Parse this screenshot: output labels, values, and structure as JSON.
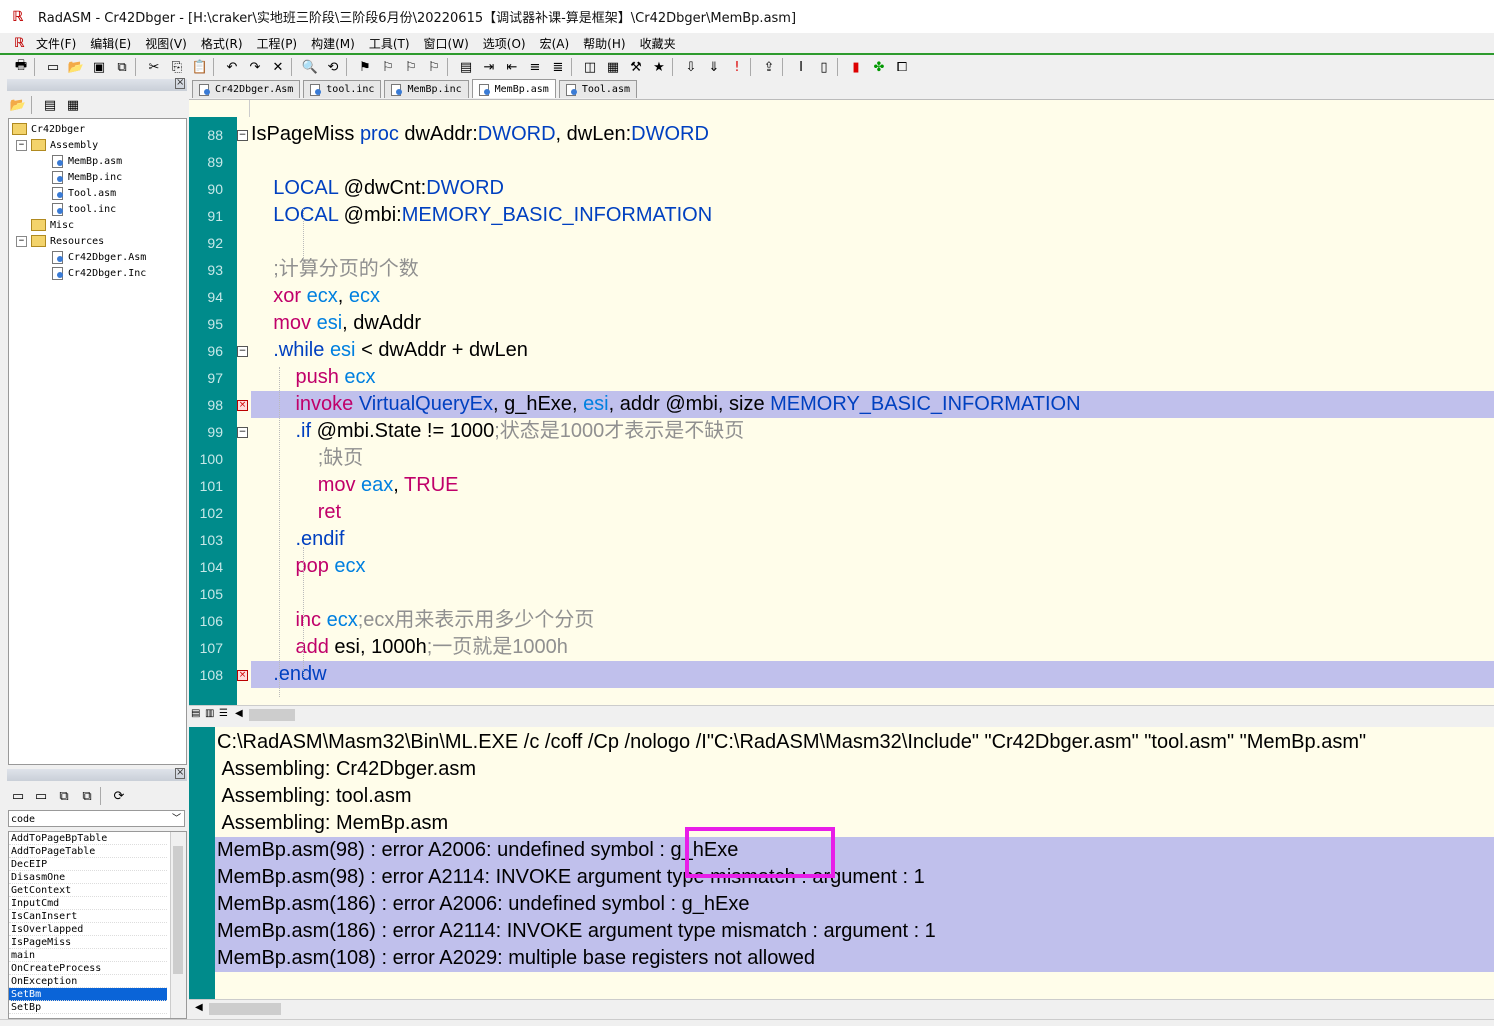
{
  "window": {
    "title": "RadASM - Cr42Dbger - [H:\\craker\\实地班三阶段\\三阶段6月份\\20220615【调试器补课-算是框架】\\Cr42Dbger\\MemBp.asm]"
  },
  "menu": [
    "文件(F)",
    "编辑(E)",
    "视图(V)",
    "格式(R)",
    "工程(P)",
    "构建(M)",
    "工具(T)",
    "窗口(W)",
    "选项(O)",
    "宏(A)",
    "帮助(H)",
    "收藏夹"
  ],
  "tabs": [
    "Cr42Dbger.Asm",
    "tool.inc",
    "MemBp.inc",
    "MemBp.asm",
    "Tool.asm"
  ],
  "active_tab": "MemBp.asm",
  "project": {
    "root": "Cr42Dbger",
    "groups": [
      {
        "name": "Assembly",
        "files": [
          "MemBp.asm",
          "MemBp.inc",
          "Tool.asm",
          "tool.inc"
        ]
      },
      {
        "name": "Misc",
        "files": []
      },
      {
        "name": "Resources",
        "files": [
          "Cr42Dbger.Asm",
          "Cr42Dbger.Inc"
        ]
      }
    ]
  },
  "properties": {
    "combo": "code",
    "procs": [
      "AddToPageBpTable",
      "AddToPageTable",
      "DecEIP",
      "DisasmOne",
      "GetContext",
      "InputCmd",
      "IsCanInsert",
      "IsOverlapped",
      "IsPageMiss",
      "main",
      "OnCreateProcess",
      "OnException",
      "SetBm",
      "SetBp"
    ],
    "selected": "SetBm"
  },
  "code": {
    "line_numbers": [
      "88",
      "89",
      "90",
      "91",
      "92",
      "93",
      "94",
      "95",
      "96",
      "97",
      "98",
      "99",
      "100",
      "101",
      "102",
      "103",
      "104",
      "105",
      "106",
      "107",
      "108"
    ],
    "highlight_lines": [
      "98",
      "108"
    ],
    "lines": [
      [
        [
          "nm",
          "IsPageMiss "
        ],
        [
          "dir",
          "proc "
        ],
        [
          "nm",
          "dwAddr"
        ],
        [
          "op",
          ":"
        ],
        [
          "typ",
          "DWORD"
        ],
        [
          "op",
          ", "
        ],
        [
          "nm",
          "dwLen"
        ],
        [
          "op",
          ":"
        ],
        [
          "typ",
          "DWORD"
        ]
      ],
      [],
      [
        [
          "nm",
          "    "
        ],
        [
          "dir",
          "LOCAL "
        ],
        [
          "nm",
          "@dwCnt"
        ],
        [
          "op",
          ":"
        ],
        [
          "typ",
          "DWORD"
        ]
      ],
      [
        [
          "nm",
          "    "
        ],
        [
          "dir",
          "LOCAL "
        ],
        [
          "nm",
          "@mbi"
        ],
        [
          "op",
          ":"
        ],
        [
          "typ",
          "MEMORY_BASIC_INFORMATION"
        ]
      ],
      [],
      [
        [
          "nm",
          "    "
        ],
        [
          "cm",
          ";计算分页的个数"
        ]
      ],
      [
        [
          "nm",
          "    "
        ],
        [
          "kw",
          "xor "
        ],
        [
          "reg",
          "ecx"
        ],
        [
          "op",
          ", "
        ],
        [
          "reg",
          "ecx"
        ]
      ],
      [
        [
          "nm",
          "    "
        ],
        [
          "kw",
          "mov "
        ],
        [
          "reg",
          "esi"
        ],
        [
          "op",
          ", "
        ],
        [
          "nm",
          "dwAddr"
        ]
      ],
      [
        [
          "nm",
          "    "
        ],
        [
          "dir",
          ".while "
        ],
        [
          "reg",
          "esi "
        ],
        [
          "op",
          "< "
        ],
        [
          "nm",
          "dwAddr "
        ],
        [
          "op",
          "+ "
        ],
        [
          "nm",
          "dwLen"
        ]
      ],
      [
        [
          "nm",
          "        "
        ],
        [
          "kw",
          "push "
        ],
        [
          "reg",
          "ecx"
        ]
      ],
      [
        [
          "nm",
          "        "
        ],
        [
          "kw",
          "invoke "
        ],
        [
          "typ",
          "VirtualQueryEx"
        ],
        [
          "op",
          ", "
        ],
        [
          "nm",
          "g_hExe"
        ],
        [
          "op",
          ", "
        ],
        [
          "reg",
          "esi"
        ],
        [
          "op",
          ", "
        ],
        [
          "nm",
          "addr @mbi"
        ],
        [
          "op",
          ", "
        ],
        [
          "nm",
          "size "
        ],
        [
          "typ",
          "MEMORY_BASIC_INFORMATION"
        ]
      ],
      [
        [
          "nm",
          "        "
        ],
        [
          "dir",
          ".if "
        ],
        [
          "nm",
          "@mbi.State "
        ],
        [
          "op",
          "!= "
        ],
        [
          "nm",
          "1000"
        ],
        [
          "cm",
          ";状态是1000才表示是不缺页"
        ]
      ],
      [
        [
          "nm",
          "            "
        ],
        [
          "cm",
          ";缺页"
        ]
      ],
      [
        [
          "nm",
          "            "
        ],
        [
          "kw",
          "mov "
        ],
        [
          "reg",
          "eax"
        ],
        [
          "op",
          ", "
        ],
        [
          "kw",
          "TRUE"
        ]
      ],
      [
        [
          "nm",
          "            "
        ],
        [
          "kw",
          "ret"
        ]
      ],
      [
        [
          "nm",
          "        "
        ],
        [
          "dir",
          ".endif"
        ]
      ],
      [
        [
          "nm",
          "        "
        ],
        [
          "kw",
          "pop "
        ],
        [
          "reg",
          "ecx"
        ]
      ],
      [],
      [
        [
          "nm",
          "        "
        ],
        [
          "kw",
          "inc "
        ],
        [
          "reg",
          "ecx"
        ],
        [
          "cm",
          ";ecx用来表示用多少个分页"
        ]
      ],
      [
        [
          "nm",
          "        "
        ],
        [
          "kw",
          "add "
        ],
        [
          "nm",
          "esi"
        ],
        [
          "op",
          ", "
        ],
        [
          "nm",
          "1000h"
        ],
        [
          "cm",
          ";一页就是1000h"
        ]
      ],
      [
        [
          "nm",
          "    "
        ],
        [
          "dir",
          ".endw"
        ]
      ]
    ]
  },
  "output": {
    "lines": [
      "C:\\RadASM\\Masm32\\Bin\\ML.EXE /c /coff /Cp /nologo /I\"C:\\RadASM\\Masm32\\Include\" \"Cr42Dbger.asm\" \"tool.asm\" \"MemBp.asm\"",
      " Assembling: Cr42Dbger.asm",
      " Assembling: tool.asm",
      " Assembling: MemBp.asm",
      "MemBp.asm(98) : error A2006: undefined symbol : g_hExe",
      "MemBp.asm(98) : error A2114: INVOKE argument type mismatch : argument : 1",
      "MemBp.asm(186) : error A2006: undefined symbol : g_hExe",
      "MemBp.asm(186) : error A2114: INVOKE argument type mismatch : argument : 1",
      "MemBp.asm(108) : error A2029: multiple base registers not allowed"
    ],
    "highlight_from": 4
  },
  "colors": {
    "editor_bg": "#fffdea",
    "gutter": "#008b8b",
    "highlight": "#c0c0ec",
    "keyword": "#c0006a",
    "directive": "#0040c0",
    "register": "#0080e0",
    "comment": "#909090",
    "annotation": "#e81ee8"
  }
}
